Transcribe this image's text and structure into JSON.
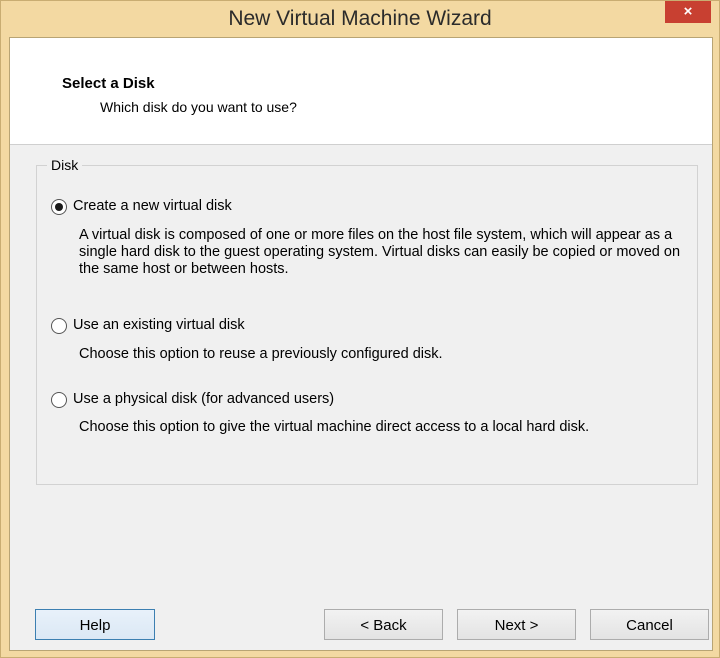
{
  "window": {
    "title": "New Virtual Machine Wizard",
    "close_label": "×"
  },
  "header": {
    "title": "Select a Disk",
    "subtitle": "Which disk do you want to use?"
  },
  "disk_group": {
    "legend": "Disk",
    "options": [
      {
        "label": "Create a new virtual disk",
        "checked": true,
        "description": "A virtual disk is composed of one or more files on the host file system, which will appear as a single hard disk to the guest operating system. Virtual disks can easily be copied or moved on the same host or between hosts."
      },
      {
        "label": "Use an existing virtual disk",
        "checked": false,
        "description": "Choose this option to reuse a previously configured disk."
      },
      {
        "label": "Use a physical disk (for advanced users)",
        "checked": false,
        "description": "Choose this option to give the virtual machine direct access to a local hard disk."
      }
    ]
  },
  "buttons": {
    "help": "Help",
    "back": "< Back",
    "next": "Next >",
    "cancel": "Cancel"
  }
}
